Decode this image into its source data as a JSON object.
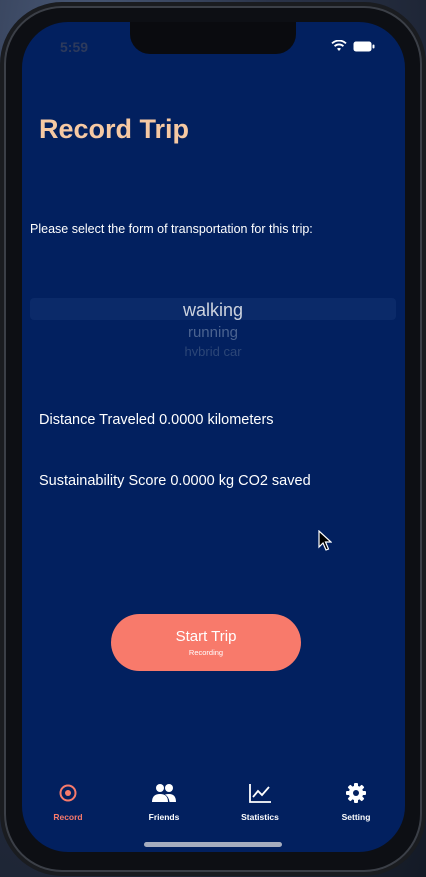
{
  "status_bar": {
    "time": "5:59"
  },
  "page": {
    "title": "Record Trip",
    "prompt": "Please select the form of transportation for this trip:"
  },
  "picker": {
    "options": [
      "walking",
      "running",
      "hybrid car"
    ],
    "selected": "walking"
  },
  "metrics": {
    "distance": "Distance Traveled 0.0000 kilometers",
    "score": "Sustainability Score 0.0000 kg CO2 saved"
  },
  "start_button": {
    "label": "Start Trip",
    "sublabel": "Recording"
  },
  "tabbar": {
    "items": [
      {
        "label": "Record",
        "icon": "record-icon",
        "active": true
      },
      {
        "label": "Friends",
        "icon": "friends-icon",
        "active": false
      },
      {
        "label": "Statistics",
        "icon": "statistics-icon",
        "active": false
      },
      {
        "label": "Setting",
        "icon": "gear-icon",
        "active": false
      }
    ]
  },
  "colors": {
    "background": "#02205f",
    "title": "#f6c9a3",
    "accent": "#f87a6b",
    "text": "#ffffff"
  }
}
